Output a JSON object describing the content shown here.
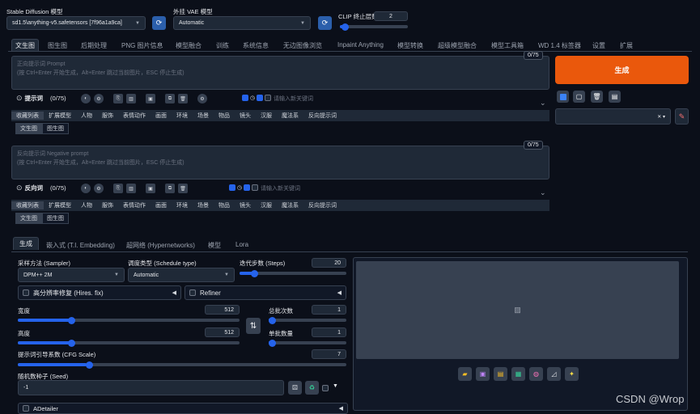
{
  "top": {
    "model_label": "Stable Diffusion 模型",
    "model_value": "sd1.5\\anything-v5.safetensors [7f96a1a9ca]",
    "vae_label": "外挂 VAE 模型",
    "vae_value": "Automatic",
    "clip_label": "CLIP 终止层数",
    "clip_value": "2"
  },
  "tabs": [
    "文生图",
    "图生图",
    "后期处理",
    "PNG 图片信息",
    "模型融合",
    "训练",
    "系统信息",
    "无边图像浏览",
    "Inpaint Anything",
    "模型转换",
    "超级模型融合",
    "模型工具箱",
    "WD 1.4 标签器",
    "设置",
    "扩展"
  ],
  "prompt": {
    "placeholder_line1": "正向提示词 Prompt",
    "placeholder_line2": "(按 Ctrl+Enter 开始生成，Alt+Enter 跳过当前图片，ESC 停止生成)",
    "counter": "0/75",
    "toolbar_title": "提示词",
    "toolbar_count": "(0/75)",
    "keyword_placeholder": "请输入新关键词"
  },
  "neg": {
    "placeholder_line1": "反向提示词 Negative prompt",
    "placeholder_line2": "(按 Ctrl+Enter 开始生成，Alt+Enter 跳过当前图片，ESC 停止生成)",
    "counter": "0/75",
    "toolbar_title": "反向词",
    "toolbar_count": "(0/75)",
    "keyword_placeholder": "请输入新关键词"
  },
  "categories": [
    "收藏列表",
    "扩展模型",
    "人物",
    "服饰",
    "表情动作",
    "画面",
    "环境",
    "场景",
    "物品",
    "镜头",
    "汉服",
    "魔法系",
    "反向提示词"
  ],
  "subtabs": [
    "文生图",
    "图生图"
  ],
  "generate": "生成",
  "param_tabs": [
    "生成",
    "嵌入式 (T.I. Embedding)",
    "超网络 (Hypernetworks)",
    "模型",
    "Lora"
  ],
  "sampler": {
    "label": "采样方法 (Sampler)",
    "value": "DPM++ 2M"
  },
  "schedule": {
    "label": "调度类型 (Schedule type)",
    "value": "Automatic"
  },
  "steps": {
    "label": "迭代步数 (Steps)",
    "value": "20"
  },
  "hires": "高分辨率修复 (Hires. fix)",
  "refiner": "Refiner",
  "width": {
    "label": "宽度",
    "value": "512"
  },
  "height": {
    "label": "高度",
    "value": "512"
  },
  "batch_count": {
    "label": "总批次数",
    "value": "1"
  },
  "batch_size": {
    "label": "单批数量",
    "value": "1"
  },
  "cfg": {
    "label": "提示词引导系数 (CFG Scale)",
    "value": "7"
  },
  "seed": {
    "label": "随机数种子 (Seed)",
    "value": "-1"
  },
  "adetailer": "ADetailer",
  "watermark": "CSDN @Wrop"
}
